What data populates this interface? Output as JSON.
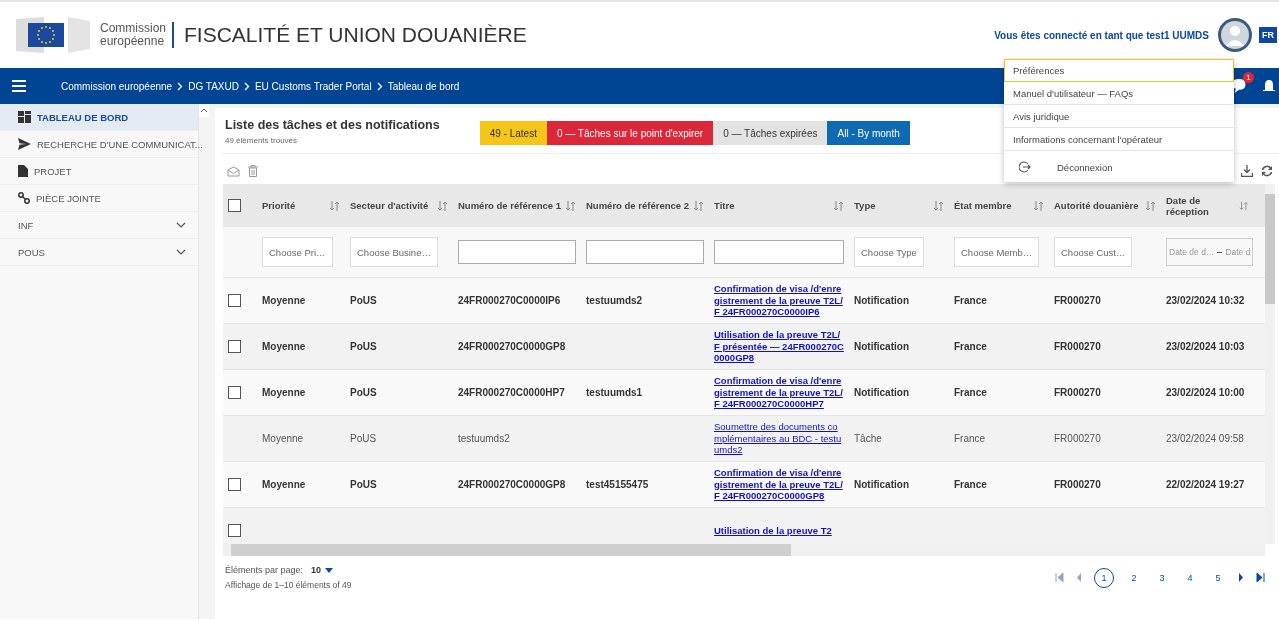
{
  "header": {
    "logo_text": [
      "Commission",
      "européenne"
    ],
    "title": "FISCALITÉ ET UNION DOUANIÈRE",
    "user_text": "Vous êtes connecté en tant que test1 UUMDS",
    "language": "FR"
  },
  "nav": {
    "breadcrumb": [
      "Commission européenne",
      "DG TAXUD",
      "EU Customs Trader Portal",
      "Tableau de bord"
    ],
    "chat_badge": "1"
  },
  "user_menu": {
    "items": [
      {
        "label": "Préférences",
        "selected": true
      },
      {
        "label": "Manuel d'utilisateur — FAQs",
        "selected": false
      },
      {
        "label": "Avis juridique",
        "selected": false
      },
      {
        "label": "Informations concernant l'opérateur",
        "selected": false
      },
      {
        "label": "Déconnexion",
        "selected": false,
        "kind": "logout"
      }
    ]
  },
  "sidebar": {
    "items": [
      {
        "label": "TABLEAU DE BORD",
        "selected": true,
        "kind": "link"
      },
      {
        "label": "RECHERCHE D'UNE COMMUNICAT...",
        "selected": false,
        "kind": "link"
      },
      {
        "label": "PROJET",
        "selected": false,
        "kind": "link"
      },
      {
        "label": "PIÈCE JOINTE",
        "selected": false,
        "kind": "link"
      },
      {
        "label": "INF",
        "selected": false,
        "kind": "group",
        "expanded": false
      },
      {
        "label": "POUS",
        "selected": false,
        "kind": "group",
        "expanded": false
      }
    ]
  },
  "panel": {
    "title": "Liste des tâches et des notifications",
    "subtitle": "49 éléments trouvés",
    "filters": [
      {
        "label": "49 - Latest",
        "color": "#f5c518"
      },
      {
        "label": "0 — Tâches sur le point d'expirer",
        "color": "#dc2639"
      },
      {
        "label": "0 — Tâches expirées",
        "color": "#e3e3e3"
      },
      {
        "label": "All - By month",
        "color": "#0e6bb3"
      }
    ]
  },
  "table": {
    "select_all_checked": false,
    "columns": [
      {
        "label": "Priorité",
        "filter": {
          "kind": "select",
          "placeholder": "Choose Pri…"
        }
      },
      {
        "label": "Secteur d'activité",
        "filter": {
          "kind": "select",
          "placeholder": "Choose Busine…"
        }
      },
      {
        "label": "Numéro de référence 1",
        "filter": {
          "kind": "text"
        }
      },
      {
        "label": "Numéro de référence 2",
        "filter": {
          "kind": "text"
        }
      },
      {
        "label": "Titre",
        "filter": {
          "kind": "text"
        }
      },
      {
        "label": "Type",
        "filter": {
          "kind": "select",
          "placeholder": "Choose Type"
        }
      },
      {
        "label": "État membre",
        "filter": {
          "kind": "select",
          "placeholder": "Choose Memb…"
        }
      },
      {
        "label": "Autorité douanière",
        "filter": {
          "kind": "select",
          "placeholder": "Choose Cust…"
        }
      },
      {
        "label": "Date de réception",
        "filter": {
          "kind": "date",
          "placeholder": "Date de d…",
          "placeholder_end": "Date d"
        }
      }
    ],
    "rows": [
      {
        "kind": "notification",
        "unread": true,
        "checked": false,
        "cells": [
          "Moyenne",
          "PoUS",
          "24FR000270C0000IP6",
          "testuumds2",
          "Confirmation de visa /d'enregistrement de la preuve T2L/F 24FR000270C0000IP6",
          "Notification",
          "France",
          "FR000270",
          "23/02/2024 10:32"
        ]
      },
      {
        "kind": "notification",
        "unread": true,
        "checked": false,
        "cells": [
          "Moyenne",
          "PoUS",
          "24FR000270C0000GP8",
          "",
          "Utilisation de la preuve T2L/F présentée — 24FR000270C0000GP8",
          "Notification",
          "France",
          "FR000270",
          "23/02/2024 10:03"
        ]
      },
      {
        "kind": "notification",
        "unread": true,
        "checked": false,
        "cells": [
          "Moyenne",
          "PoUS",
          "24FR000270C0000HP7",
          "testuumds1",
          "Confirmation de visa /d'enregistrement de la preuve T2L/F 24FR000270C0000HP7",
          "Notification",
          "France",
          "FR000270",
          "23/02/2024 10:00"
        ]
      },
      {
        "kind": "task",
        "unread": false,
        "cells": [
          "Moyenne",
          "PoUS",
          "testuumds2",
          "",
          "Soumettre des documents complémentaires au BDC - testuumds2",
          "Tâche",
          "France",
          "FR000270",
          "23/02/2024 09:58"
        ]
      },
      {
        "kind": "notification",
        "unread": true,
        "checked": false,
        "cells": [
          "Moyenne",
          "PoUS",
          "24FR000270C0000GP8",
          "test45155475",
          "Confirmation de visa /d'enregistrement de la preuve T2L/F 24FR000270C0000GP8",
          "Notification",
          "France",
          "FR000270",
          "22/02/2024 19:27"
        ]
      },
      {
        "kind": "notification",
        "unread": true,
        "checked": false,
        "cells": [
          "",
          "",
          "",
          "",
          "Utilisation de la preuve T2",
          "",
          "",
          "",
          ""
        ]
      }
    ]
  },
  "footer": {
    "per_page_label": "Éléments par page:",
    "per_page": "10",
    "range": "Affichage de 1–10 éléments of 49",
    "pages": [
      {
        "label": "1",
        "selected": true
      },
      {
        "label": "2",
        "selected": false
      },
      {
        "label": "3",
        "selected": false
      },
      {
        "label": "4",
        "selected": false
      },
      {
        "label": "5",
        "selected": false
      }
    ]
  }
}
